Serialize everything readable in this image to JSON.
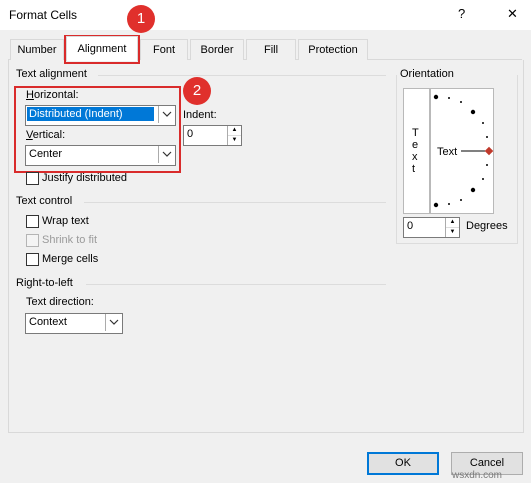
{
  "window": {
    "title": "Format Cells",
    "help_glyph": "?",
    "close_glyph": "✕"
  },
  "tabs": [
    {
      "label": "Number"
    },
    {
      "label": "Alignment"
    },
    {
      "label": "Font"
    },
    {
      "label": "Border"
    },
    {
      "label": "Fill"
    },
    {
      "label": "Protection"
    }
  ],
  "text_alignment": {
    "group_label": "Text alignment",
    "horizontal_label": "Horizontal:",
    "horizontal_value": "Distributed (Indent)",
    "vertical_label": "Vertical:",
    "vertical_value": "Center",
    "indent_label": "Indent:",
    "indent_value": "0",
    "justify_label": "Justify distributed"
  },
  "text_control": {
    "group_label": "Text control",
    "wrap_label": "Wrap text",
    "shrink_label": "Shrink to fit",
    "merge_label": "Merge cells"
  },
  "rtl": {
    "group_label": "Right-to-left",
    "direction_label": "Text direction:",
    "direction_value": "Context"
  },
  "orientation": {
    "group_label": "Orientation",
    "vertical_text": [
      "T",
      "e",
      "x",
      "t"
    ],
    "dial_text": "Text",
    "degrees_value": "0",
    "degrees_label": "Degrees"
  },
  "buttons": {
    "ok": "OK",
    "cancel": "Cancel"
  },
  "annotations": [
    {
      "number": "1"
    },
    {
      "number": "2"
    }
  ],
  "watermark": "wsxdn.com",
  "colors": {
    "accent": "#0078d7",
    "highlight_red": "#d92b2b",
    "badge_red": "#e0302c"
  }
}
